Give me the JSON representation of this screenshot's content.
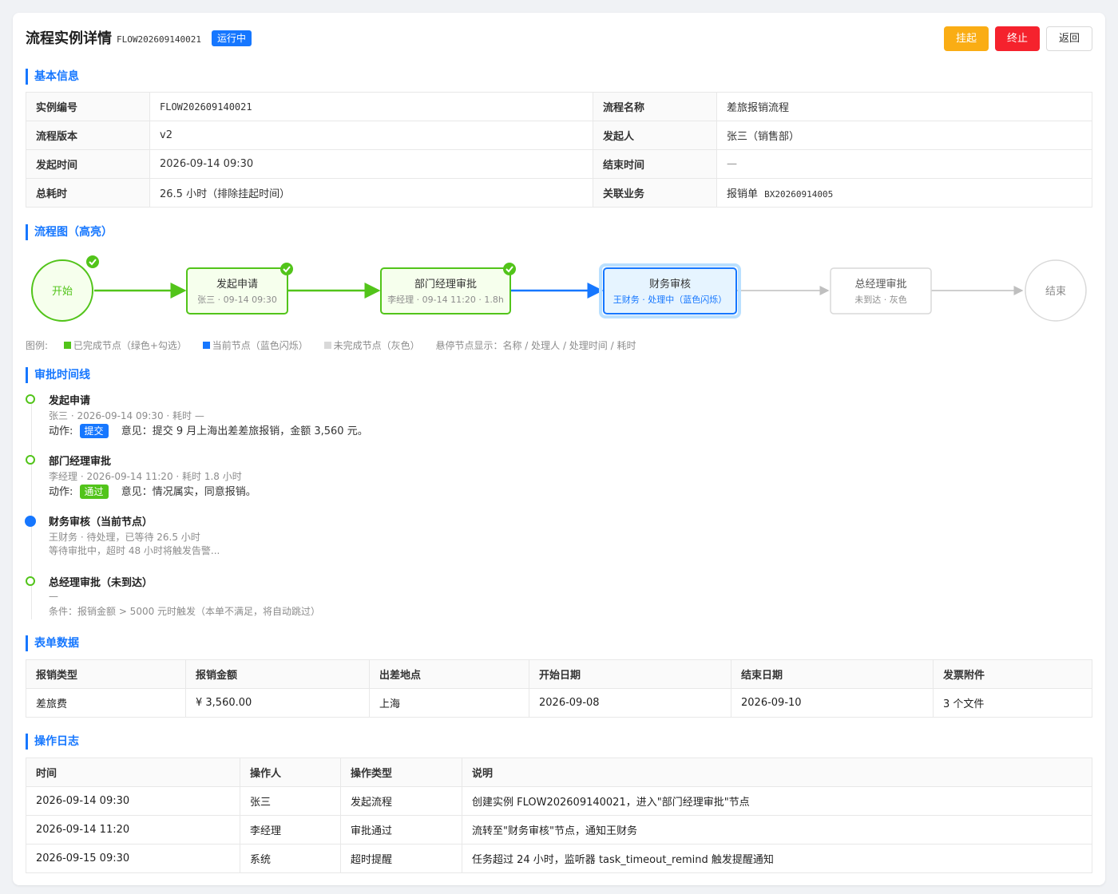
{
  "header": {
    "title": "流程实例详情",
    "instance_id": "FLOW202609140021",
    "status": "运行中",
    "buttons": {
      "suspend": "挂起",
      "terminate": "终止",
      "back": "返回"
    }
  },
  "sections": {
    "basic": "基本信息",
    "diagram": "流程图（高亮）",
    "timeline": "审批时间线",
    "form": "表单数据",
    "log": "操作日志"
  },
  "basic_info": {
    "instance_no_label": "实例编号",
    "instance_no": "FLOW202609140021",
    "flow_name_label": "流程名称",
    "flow_name": "差旅报销流程",
    "version_label": "流程版本",
    "version": "v2",
    "initiator_label": "发起人",
    "initiator": "张三（销售部）",
    "start_time_label": "发起时间",
    "start_time": "2026-09-14 09:30",
    "end_time_label": "结束时间",
    "end_time": "—",
    "duration_label": "总耗时",
    "duration": "26.5 小时（排除挂起时间）",
    "business_label": "关联业务",
    "business_prefix": "报销单",
    "business_id": "BX20260914005"
  },
  "diagram": {
    "start": "开始",
    "end": "结束",
    "nodes": [
      {
        "name": "发起申请",
        "sub": "张三 · 09-14 09:30",
        "state": "done"
      },
      {
        "name": "部门经理审批",
        "sub": "李经理 · 09-14 11:20 · 1.8h",
        "state": "done"
      },
      {
        "name": "财务审核",
        "sub": "王财务 · 处理中（蓝色闪烁）",
        "state": "current"
      },
      {
        "name": "总经理审批",
        "sub": "未到达 · 灰色",
        "state": "pending"
      }
    ],
    "colors": {
      "done": "#52c41a",
      "current": "#1677ff",
      "pending": "#d9d9d9"
    }
  },
  "legend": {
    "label": "图例:",
    "done": "已完成节点（绿色+勾选）",
    "current": "当前节点（蓝色闪烁）",
    "pending": "未完成节点（灰色）",
    "hover": "悬停节点显示：名称 / 处理人 / 处理时间 / 耗时"
  },
  "timeline": [
    {
      "title": "发起申请",
      "meta": "张三 · 2026-09-14 09:30 · 耗时 —",
      "action_label": "动作:",
      "action": "提交",
      "comment": "意见：提交 9 月上海出差差旅报销，金额 3,560 元。"
    },
    {
      "title": "部门经理审批",
      "meta": "李经理 · 2026-09-14 11:20 · 耗时 1.8 小时",
      "action_label": "动作:",
      "action": "通过",
      "comment": "意见：情况属实，同意报销。"
    },
    {
      "title": "财务审核（当前节点）",
      "meta": "王财务 · 待处理，已等待 26.5 小时",
      "note": "等待审批中，超时 48 小时将触发告警..."
    },
    {
      "title": "总经理审批（未到达）",
      "meta": "—",
      "note": "条件：报销金额 > 5000 元时触发（本单不满足，将自动跳过）"
    }
  ],
  "form_table": {
    "headers": [
      "报销类型",
      "报销金额",
      "出差地点",
      "开始日期",
      "结束日期",
      "发票附件"
    ],
    "row": [
      "差旅费",
      "¥ 3,560.00",
      "上海",
      "2026-09-08",
      "2026-09-10",
      "3 个文件"
    ]
  },
  "log_table": {
    "headers": [
      "时间",
      "操作人",
      "操作类型",
      "说明"
    ],
    "rows": [
      [
        "2026-09-14 09:30",
        "张三",
        "发起流程",
        "创建实例 FLOW202609140021，进入\"部门经理审批\"节点"
      ],
      [
        "2026-09-14 11:20",
        "李经理",
        "审批通过",
        "流转至\"财务审核\"节点，通知王财务"
      ],
      [
        "2026-09-15 09:30",
        "系统",
        "超时提醒",
        "任务超过 24 小时，监听器 task_timeout_remind 触发提醒通知"
      ]
    ]
  }
}
